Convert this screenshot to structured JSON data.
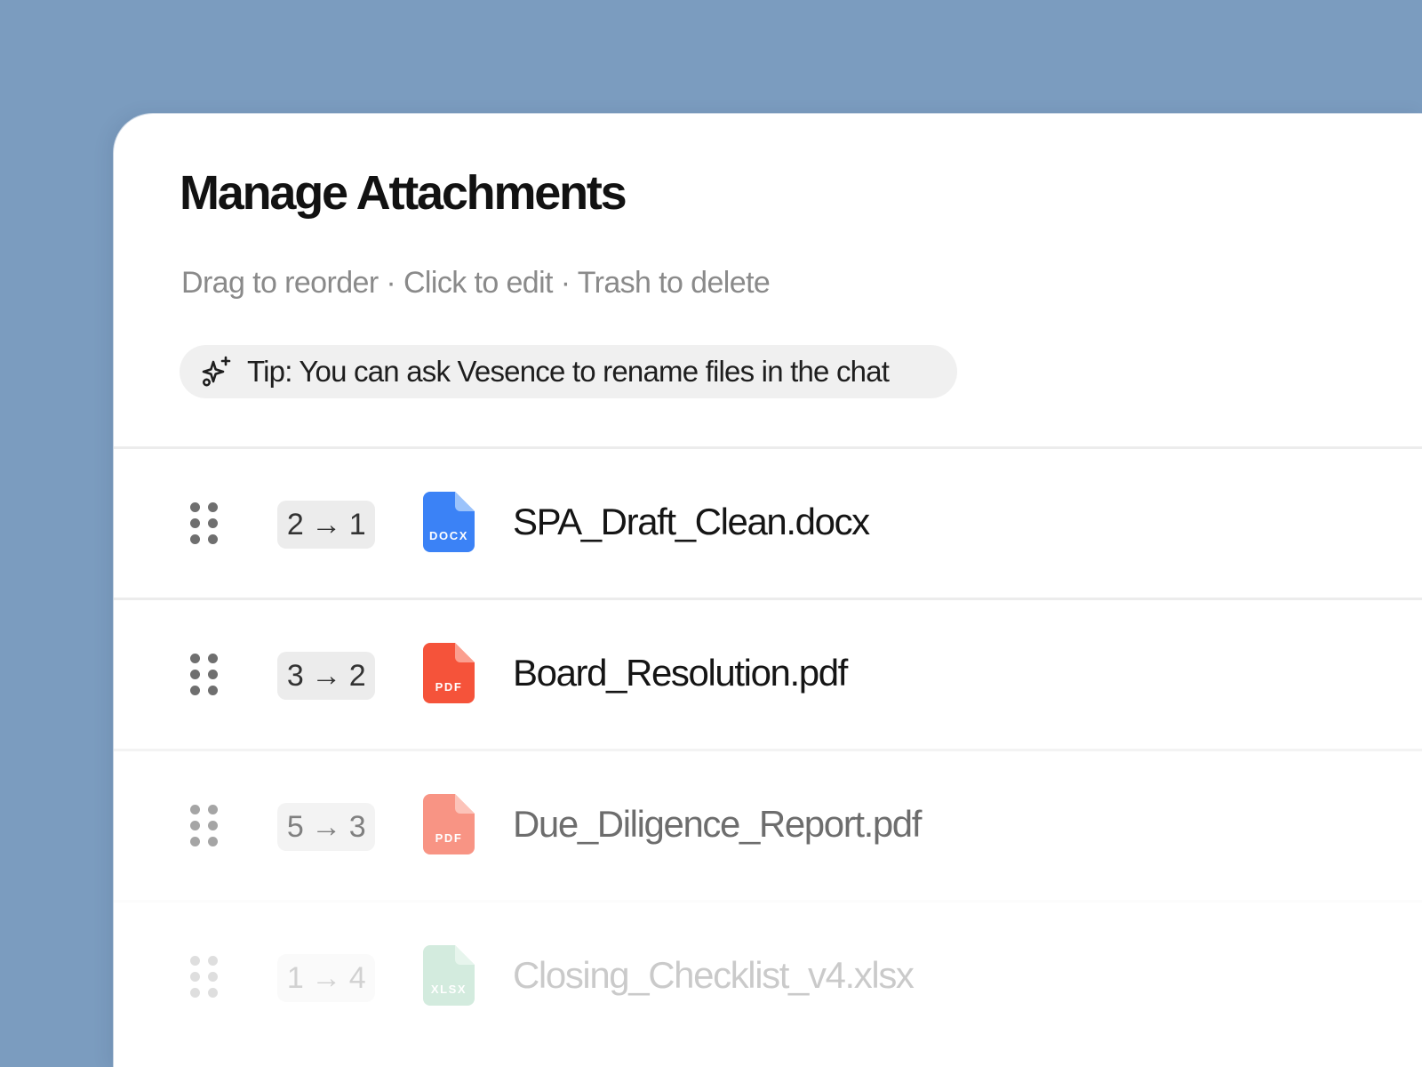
{
  "dialog": {
    "title": "Manage Attachments",
    "subtitle": "Drag to reorder · Click to edit · Trash to delete",
    "tip": {
      "icon": "sparkles-icon",
      "text": "Tip: You can ask Vesence to rename files in the chat"
    }
  },
  "attachments": [
    {
      "order_change": "2 → 1",
      "file_type": "DOCX",
      "icon_color": "#3b82f6",
      "fold_color": "#9cc3fb",
      "name": "SPA_Draft_Clean.docx"
    },
    {
      "order_change": "3 → 2",
      "file_type": "PDF",
      "icon_color": "#f5533a",
      "fold_color": "#fb9f8f",
      "name": "Board_Resolution.pdf"
    },
    {
      "order_change": "5 → 3",
      "file_type": "PDF",
      "icon_color": "#f5533a",
      "fold_color": "#fb9f8f",
      "name": "Due_Diligence_Report.pdf"
    },
    {
      "order_change": "1 → 4",
      "file_type": "XLSX",
      "icon_color": "#3aa86b",
      "fold_color": "#95d6b0",
      "name": "Closing_Checklist_v4.xlsx"
    }
  ]
}
